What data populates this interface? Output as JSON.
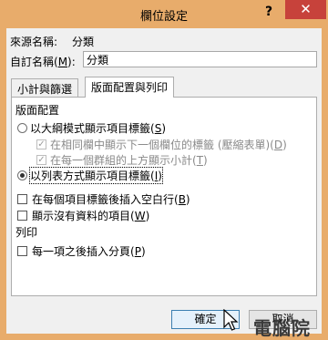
{
  "window": {
    "title": "欄位設定",
    "help_label": "?",
    "close_label": "✕",
    "titlebar_color": "#e8ac6b",
    "close_color": "#c7423b"
  },
  "source_name": {
    "label": "來源名稱:",
    "value": "分類"
  },
  "custom_name": {
    "label_prefix": "自訂名稱(",
    "label_key": "M",
    "label_suffix": "):",
    "value": "分類"
  },
  "tabs": [
    {
      "label": "小計與篩選",
      "active": false
    },
    {
      "label": "版面配置與列印",
      "active": true
    }
  ],
  "layout": {
    "section_label": "版面配置",
    "outline_option": {
      "prefix": "以大綱模式顯示項目標籤(",
      "key": "S",
      "suffix": ")",
      "selected": false
    },
    "same_column_option": {
      "prefix": "在相同欄中顯示下一個欄位的標籤 (壓縮表單)(",
      "key": "D",
      "suffix": ")",
      "checked": true,
      "disabled": true
    },
    "top_subtotal_option": {
      "prefix": "在每一個群組的上方顯示小計(",
      "key": "T",
      "suffix": ")",
      "checked": true,
      "disabled": true
    },
    "tabular_option": {
      "prefix": "以列表方式顯示項目標籤(",
      "key": "I",
      "suffix": ")",
      "selected": true
    },
    "blank_line_option": {
      "prefix": "在每個項目標籤後插入空白行(",
      "key": "B",
      "suffix": ")",
      "checked": false
    },
    "no_data_option": {
      "prefix": "顯示沒有資料的項目(",
      "key": "W",
      "suffix": ")",
      "checked": false
    }
  },
  "print": {
    "section_label": "列印",
    "page_break_option": {
      "prefix": "每一項之後插入分頁(",
      "key": "P",
      "suffix": ")",
      "checked": false
    }
  },
  "buttons": {
    "ok": "確定",
    "cancel": "取消"
  },
  "watermark": "電腦院",
  "icons": {
    "cursor": "mouse-pointer-icon",
    "check": "check-icon"
  }
}
